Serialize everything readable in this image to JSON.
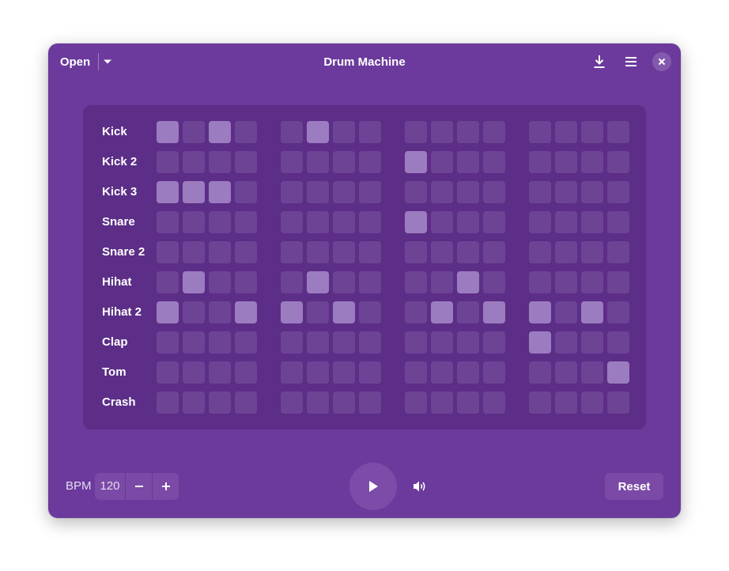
{
  "header": {
    "open_label": "Open",
    "title": "Drum Machine",
    "icons": [
      "download-icon",
      "hamburger-menu-icon",
      "close-icon"
    ]
  },
  "tracks": [
    {
      "name": "Kick",
      "steps": [
        1,
        0,
        1,
        0,
        0,
        1,
        0,
        0,
        0,
        0,
        0,
        0,
        0,
        0,
        0,
        0
      ]
    },
    {
      "name": "Kick 2",
      "steps": [
        0,
        0,
        0,
        0,
        0,
        0,
        0,
        0,
        1,
        0,
        0,
        0,
        0,
        0,
        0,
        0
      ]
    },
    {
      "name": "Kick 3",
      "steps": [
        1,
        1,
        1,
        0,
        0,
        0,
        0,
        0,
        0,
        0,
        0,
        0,
        0,
        0,
        0,
        0
      ]
    },
    {
      "name": "Snare",
      "steps": [
        0,
        0,
        0,
        0,
        0,
        0,
        0,
        0,
        1,
        0,
        0,
        0,
        0,
        0,
        0,
        0
      ]
    },
    {
      "name": "Snare 2",
      "steps": [
        0,
        0,
        0,
        0,
        0,
        0,
        0,
        0,
        0,
        0,
        0,
        0,
        0,
        0,
        0,
        0
      ]
    },
    {
      "name": "Hihat",
      "steps": [
        0,
        1,
        0,
        0,
        0,
        1,
        0,
        0,
        0,
        0,
        1,
        0,
        0,
        0,
        0,
        0
      ]
    },
    {
      "name": "Hihat 2",
      "steps": [
        1,
        0,
        0,
        1,
        1,
        0,
        1,
        0,
        0,
        1,
        0,
        1,
        1,
        0,
        1,
        0
      ]
    },
    {
      "name": "Clap",
      "steps": [
        0,
        0,
        0,
        0,
        0,
        0,
        0,
        0,
        0,
        0,
        0,
        0,
        1,
        0,
        0,
        0
      ]
    },
    {
      "name": "Tom",
      "steps": [
        0,
        0,
        0,
        0,
        0,
        0,
        0,
        0,
        0,
        0,
        0,
        0,
        0,
        0,
        0,
        1
      ]
    },
    {
      "name": "Crash",
      "steps": [
        0,
        0,
        0,
        0,
        0,
        0,
        0,
        0,
        0,
        0,
        0,
        0,
        0,
        0,
        0,
        0
      ]
    }
  ],
  "controls": {
    "bpm_label": "BPM",
    "bpm_value": "120",
    "decrement_symbol": "−",
    "increment_symbol": "+",
    "reset_label": "Reset"
  },
  "colors": {
    "window_bg": "#6b3a9c",
    "grid_bg": "#5c2e87",
    "step_off": "#6d4396",
    "step_on": "#9c7cc0"
  }
}
